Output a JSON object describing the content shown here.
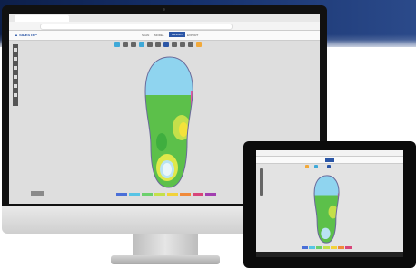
{
  "app": {
    "logo_text": "▲ SIDESTEP",
    "menu": [
      "SCAN",
      "MODEL",
      "DESIGN",
      "EXPORT"
    ],
    "active_menu_index": 2
  },
  "legend_colors": [
    "#4a6fd8",
    "#57c4e5",
    "#6cd06c",
    "#c4e04a",
    "#f2d23a",
    "#f08a3a",
    "#d8457a",
    "#a23fb0"
  ],
  "heatmap_colors": {
    "toe": "#8fd4ef",
    "mid": "#5cc04a",
    "heel": "#b9e3f3",
    "ridge": "#e35aa0",
    "hot": "#f3e23a"
  }
}
